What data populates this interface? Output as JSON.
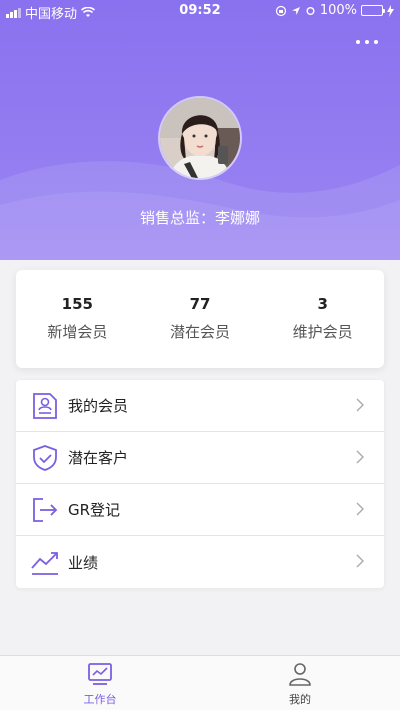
{
  "status_bar": {
    "carrier": "中国移动",
    "time": "09:52",
    "battery": "100%"
  },
  "header": {
    "user_title": "销售总监：李娜娜"
  },
  "stats": [
    {
      "value": "155",
      "label": "新增会员"
    },
    {
      "value": "77",
      "label": "潜在会员"
    },
    {
      "value": "3",
      "label": "维护会员"
    }
  ],
  "menu": [
    {
      "label": "我的会员",
      "icon": "member-card-icon"
    },
    {
      "label": "潜在客户",
      "icon": "shield-check-icon"
    },
    {
      "label": "GR登记",
      "icon": "exit-arrow-icon"
    },
    {
      "label": "业绩",
      "icon": "trend-chart-icon"
    }
  ],
  "tabbar": {
    "tabs": [
      {
        "label": "工作台",
        "icon": "workbench-chart-icon",
        "active": true
      },
      {
        "label": "我的",
        "icon": "user-icon",
        "active": false
      }
    ]
  },
  "colors": {
    "accent": "#7b5fe0",
    "header_top": "#8a71ef",
    "header_bottom": "#9a85f2",
    "battery": "#4cd964"
  }
}
